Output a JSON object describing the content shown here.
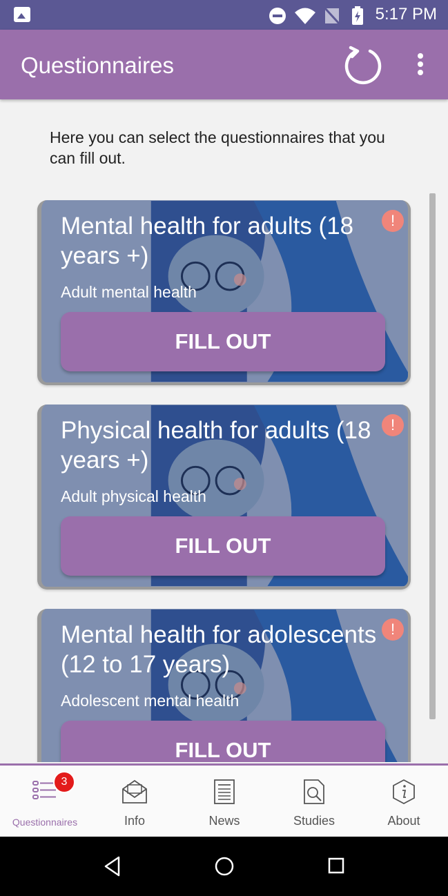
{
  "status_bar": {
    "time": "5:17 PM"
  },
  "app_bar": {
    "title": "Questionnaires"
  },
  "intro": {
    "text": "Here you can select the questionnaires that you can fill out."
  },
  "questionnaires": [
    {
      "title": "Mental health for adults (18 years +)",
      "subtitle": "Adult mental health",
      "button": "FILL OUT",
      "alert": "!"
    },
    {
      "title": "Physical health for adults (18 years +)",
      "subtitle": "Adult physical health",
      "button": "FILL OUT",
      "alert": "!"
    },
    {
      "title": "Mental health for adolescents (12 to 17 years)",
      "subtitle": "Adolescent mental health",
      "button": "FILL OUT",
      "alert": "!"
    }
  ],
  "bottom_nav": {
    "badge": "3",
    "items": [
      {
        "label": "Questionnaires",
        "icon": "checklist-icon",
        "active": true
      },
      {
        "label": "Info",
        "icon": "envelope-icon",
        "active": false
      },
      {
        "label": "News",
        "icon": "newspaper-icon",
        "active": false
      },
      {
        "label": "Studies",
        "icon": "document-search-icon",
        "active": false
      },
      {
        "label": "About",
        "icon": "info-icon",
        "active": false
      }
    ]
  },
  "colors": {
    "status_bar": "#5b5894",
    "primary": "#9a6fab",
    "card_bg": "#7f8fb0",
    "alert": "#f0857a",
    "badge": "#e31b1b"
  }
}
